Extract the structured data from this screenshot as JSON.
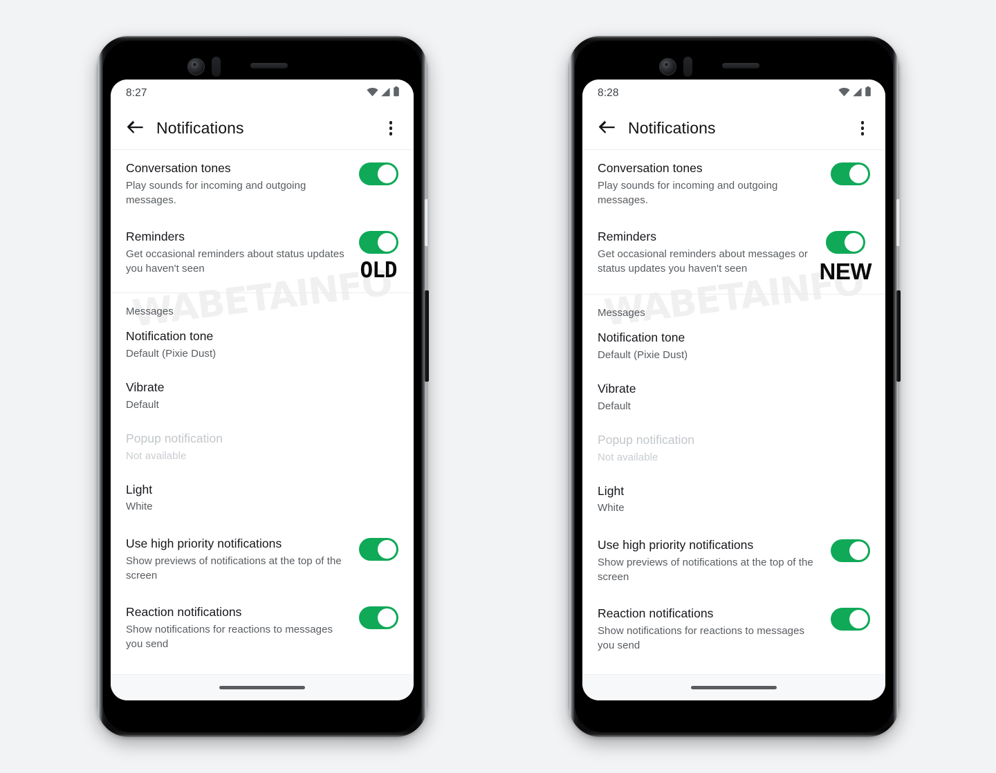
{
  "watermark": {
    "text": "WABETAINFO"
  },
  "colors": {
    "toggle_on": "#0fa958",
    "page_background": "#f2f3f5",
    "screen_background": "#ffffff",
    "title_text": "#15161a",
    "subtitle_text": "#585c60",
    "disabled_text": "#c2c6ca"
  },
  "phones": [
    {
      "id": "old",
      "status_bar": {
        "time": "8:27",
        "icons": [
          "wifi-icon",
          "signal-icon",
          "battery-icon"
        ]
      },
      "app_bar": {
        "back_label": "back-arrow-icon",
        "title": "Notifications",
        "overflow_label": "more-options-icon"
      },
      "groups": [
        {
          "rows": [
            {
              "name": "conversation-tones",
              "title": "Conversation tones",
              "subtitle": "Play sounds for incoming and outgoing messages.",
              "control": "toggle",
              "toggle_on": true,
              "badge": ""
            },
            {
              "name": "reminders",
              "title": "Reminders",
              "subtitle": "Get occasional reminders about status updates you haven't seen",
              "control": "toggle",
              "toggle_on": true,
              "badge": "OLD"
            }
          ]
        },
        {
          "section_label": "Messages",
          "rows": [
            {
              "name": "notification-tone",
              "title": "Notification tone",
              "subtitle": "Default (Pixie Dust)",
              "control": "none",
              "toggle_on": false,
              "badge": ""
            },
            {
              "name": "vibrate",
              "title": "Vibrate",
              "subtitle": "Default",
              "control": "none",
              "toggle_on": false,
              "badge": ""
            },
            {
              "name": "popup-notification",
              "title": "Popup notification",
              "subtitle": "Not available",
              "control": "none",
              "disabled": true,
              "toggle_on": false,
              "badge": ""
            },
            {
              "name": "light",
              "title": "Light",
              "subtitle": "White",
              "control": "none",
              "toggle_on": false,
              "badge": ""
            },
            {
              "name": "use-high-priority-notifications",
              "title": "Use high priority notifications",
              "subtitle": "Show previews of notifications at the top of the screen",
              "control": "toggle",
              "toggle_on": true,
              "badge": ""
            },
            {
              "name": "reaction-notifications",
              "title": "Reaction notifications",
              "subtitle": "Show notifications for reactions to messages you send",
              "control": "toggle",
              "toggle_on": true,
              "badge": ""
            }
          ]
        }
      ]
    },
    {
      "id": "new",
      "status_bar": {
        "time": "8:28",
        "icons": [
          "wifi-icon",
          "signal-icon",
          "battery-icon"
        ]
      },
      "app_bar": {
        "back_label": "back-arrow-icon",
        "title": "Notifications",
        "overflow_label": "more-options-icon"
      },
      "groups": [
        {
          "rows": [
            {
              "name": "conversation-tones",
              "title": "Conversation tones",
              "subtitle": "Play sounds for incoming and outgoing messages.",
              "control": "toggle",
              "toggle_on": true,
              "badge": ""
            },
            {
              "name": "reminders",
              "title": "Reminders",
              "subtitle": "Get occasional reminders about messages or status updates you haven't seen",
              "control": "toggle",
              "toggle_on": true,
              "badge": "NEW"
            }
          ]
        },
        {
          "section_label": "Messages",
          "rows": [
            {
              "name": "notification-tone",
              "title": "Notification tone",
              "subtitle": "Default (Pixie Dust)",
              "control": "none",
              "toggle_on": false,
              "badge": ""
            },
            {
              "name": "vibrate",
              "title": "Vibrate",
              "subtitle": "Default",
              "control": "none",
              "toggle_on": false,
              "badge": ""
            },
            {
              "name": "popup-notification",
              "title": "Popup notification",
              "subtitle": "Not available",
              "control": "none",
              "disabled": true,
              "toggle_on": false,
              "badge": ""
            },
            {
              "name": "light",
              "title": "Light",
              "subtitle": "White",
              "control": "none",
              "toggle_on": false,
              "badge": ""
            },
            {
              "name": "use-high-priority-notifications",
              "title": "Use high priority notifications",
              "subtitle": "Show previews of notifications at the top of the screen",
              "control": "toggle",
              "toggle_on": true,
              "badge": ""
            },
            {
              "name": "reaction-notifications",
              "title": "Reaction notifications",
              "subtitle": "Show notifications for reactions to messages you send",
              "control": "toggle",
              "toggle_on": true,
              "badge": ""
            }
          ]
        }
      ]
    }
  ]
}
